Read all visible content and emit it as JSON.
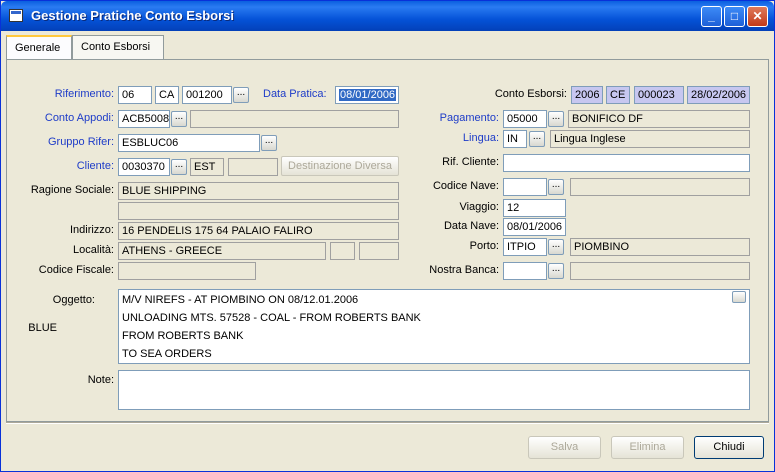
{
  "window": {
    "title": "Gestione Pratiche Conto Esborsi",
    "minimize": "_",
    "maximize": "□",
    "close": "✕"
  },
  "tabs": [
    {
      "label": "Generale",
      "active": true
    },
    {
      "label": "Conto Esborsi",
      "active": false
    }
  ],
  "form": {
    "riferimento": {
      "label": "Riferimento:",
      "anno": "06",
      "tipo": "CA",
      "numero": "001200"
    },
    "data_pratica": {
      "label": "Data Pratica:",
      "value": "08/01/2006"
    },
    "conto_esborsi": {
      "label": "Conto Esborsi:",
      "anno": "2006",
      "tipo": "CE",
      "numero": "000023",
      "data": "28/02/2006"
    },
    "conto_appoggio": {
      "label": "Conto Appodi:",
      "code": "ACB5008",
      "desc": ""
    },
    "pagamento": {
      "label": "Pagamento:",
      "code": "05000",
      "desc": "BONIFICO DF"
    },
    "gruppo_rifer": {
      "label": "Gruppo Rifer:",
      "value": "ESBLUC06"
    },
    "lingua": {
      "label": "Lingua:",
      "code": "IN",
      "desc": "Lingua Inglese"
    },
    "cliente": {
      "label": "Cliente:",
      "code": "0030370",
      "suffix": "EST",
      "extra": ""
    },
    "destinazione_diversa": "Destinazione Diversa",
    "rif_cliente": {
      "label": "Rif. Cliente:",
      "value": ""
    },
    "ragione_sociale": {
      "label": "Ragione Sociale:",
      "line1": "BLUE SHIPPING",
      "line2": ""
    },
    "codice_nave": {
      "label": "Codice Nave:",
      "code": "",
      "desc": ""
    },
    "viaggio": {
      "label": "Viaggio:",
      "value": "12"
    },
    "indirizzo": {
      "label": "Indirizzo:",
      "value": "16 PENDELIS  175 64 PALAIO FALIRO"
    },
    "data_nave": {
      "label": "Data Nave:",
      "value": "08/01/2006"
    },
    "localita": {
      "label": "Località:",
      "value": "ATHENS - GREECE",
      "extra1": "",
      "extra2": ""
    },
    "porto": {
      "label": "Porto:",
      "code": "ITPIO",
      "desc": "PIOMBINO"
    },
    "codice_fiscale": {
      "label": "Codice Fiscale:",
      "value": ""
    },
    "nostra_banca": {
      "label": "Nostra Banca:",
      "code": "",
      "desc": ""
    },
    "oggetto": {
      "label": "Oggetto:",
      "side_text": "BLUE",
      "lines": [
        "M/V NIREFS - AT PIOMBINO ON 08/12.01.2006",
        "UNLOADING MTS. 57528 - COAL - FROM ROBERTS BANK",
        "FROM ROBERTS BANK",
        "TO SEA ORDERS"
      ]
    },
    "note": {
      "label": "Note:",
      "value": ""
    }
  },
  "buttons": {
    "dots": "...",
    "salva": "Salva",
    "elimina": "Elimina",
    "chiudi": "Chiudi"
  }
}
